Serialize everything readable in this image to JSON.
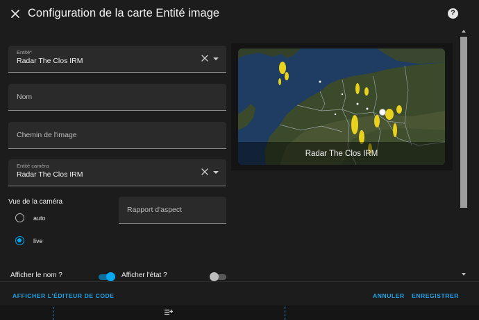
{
  "dialog": {
    "title": "Configuration de la carte Entité image",
    "close_icon": "close-icon",
    "help_icon": "help-icon",
    "help_glyph": "?"
  },
  "form": {
    "entity": {
      "label": "Entité*",
      "value": "Radar The Clos IRM"
    },
    "name": {
      "placeholder": "Nom"
    },
    "image_path": {
      "placeholder": "Chemin de l'image"
    },
    "camera_entity": {
      "label": "Entité caméra",
      "value": "Radar The Clos IRM"
    },
    "camera_view": {
      "label": "Vue de la caméra",
      "options": [
        {
          "label": "auto",
          "checked": false
        },
        {
          "label": "live",
          "checked": true
        }
      ]
    },
    "aspect_ratio": {
      "placeholder": "Rapport d'aspect"
    },
    "show_name": {
      "label": "Afficher le nom ?",
      "on": true
    },
    "show_state": {
      "label": "Afficher l'état ?",
      "on": false
    }
  },
  "preview": {
    "caption": "Radar The Clos IRM"
  },
  "footer": {
    "code_editor": "AFFICHER L'ÉDITEUR DE CODE",
    "cancel": "ANNULER",
    "save": "ENREGISTRER"
  },
  "colors": {
    "accent": "#03a9f4",
    "button_text": "#1ea4e8",
    "dialog_bg": "#1c1c1c",
    "field_bg": "#2a2a2a"
  }
}
